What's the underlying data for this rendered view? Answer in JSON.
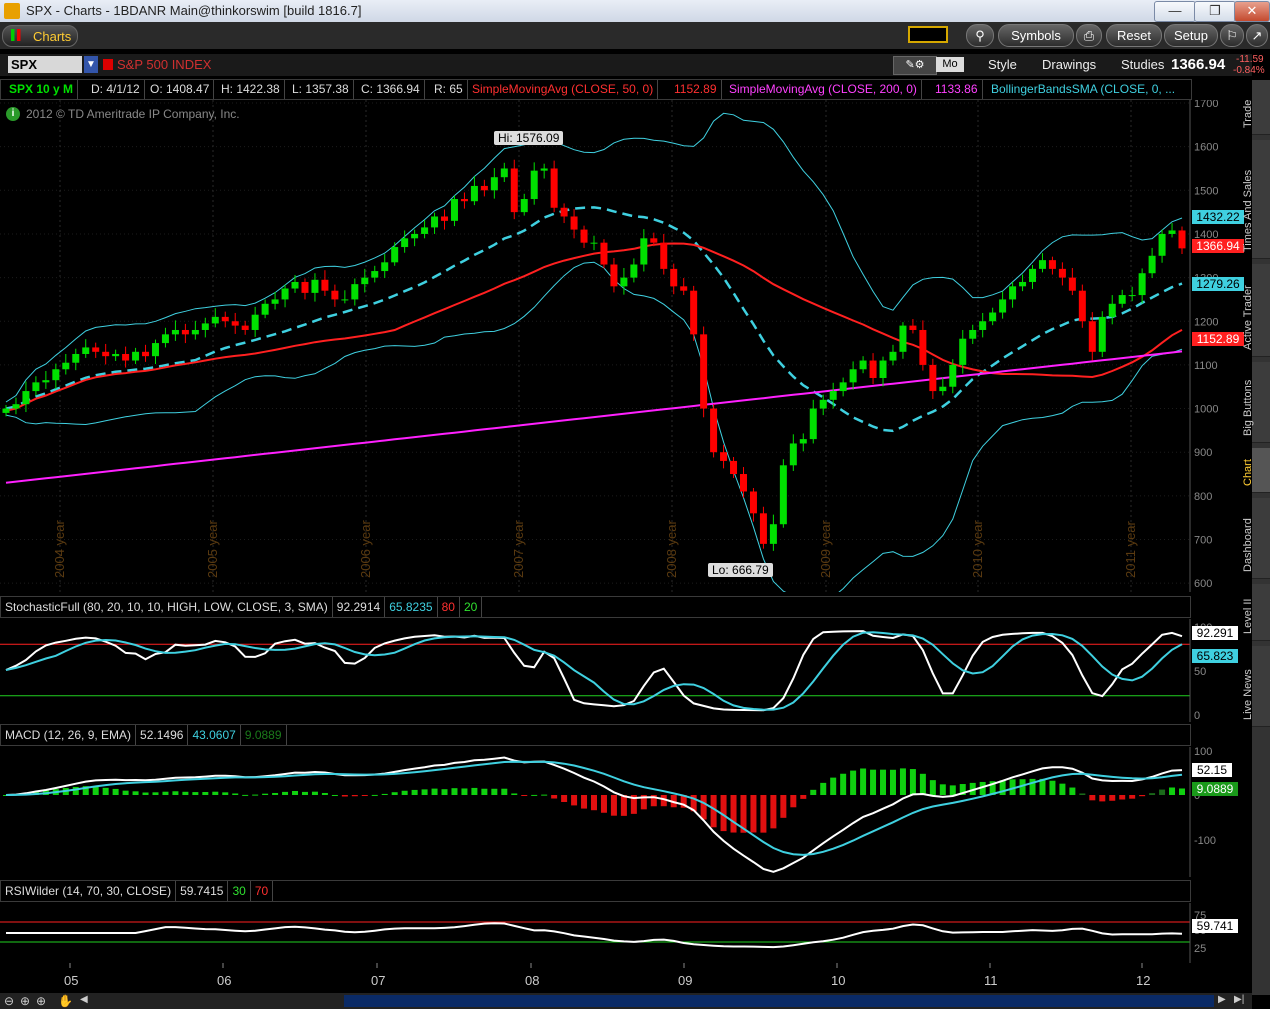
{
  "window": {
    "title": "SPX - Charts - 1BDANR Main@thinkorswim [build 1816.7]"
  },
  "toolbar": {
    "charts_label": "Charts",
    "symbols_label": "Symbols",
    "reset_label": "Reset",
    "setup_label": "Setup"
  },
  "symbolbar": {
    "symbol": "SPX",
    "description": "S&P 500 INDEX",
    "mo_label": "Mo",
    "style_label": "Style",
    "drawings_label": "Drawings",
    "studies_label": "Studies",
    "last_price": "1366.94",
    "change": "-11.59",
    "change_pct": "-0.84%"
  },
  "legend": {
    "title": "SPX 10 y M",
    "date": "D: 4/1/12",
    "open": "O: 1408.47",
    "high": "H: 1422.38",
    "low": "L: 1357.38",
    "close": "C: 1366.94",
    "range": "R: 65",
    "sma50": "SimpleMovingAvg (CLOSE, 50, 0)",
    "sma50_val": "1152.89",
    "sma200": "SimpleMovingAvg (CLOSE, 200, 0)",
    "sma200_val": "1133.86",
    "bb": "BollingerBandsSMA (CLOSE, 0, ..."
  },
  "copyright": "2012 © TD Ameritrade IP Company, Inc.",
  "price_panel": {
    "hi_label": "Hi: 1576.09",
    "lo_label": "Lo: 666.79",
    "axis_ticks": [
      "1700",
      "1600",
      "1500",
      "1400",
      "1300",
      "1200",
      "1100",
      "1000",
      "900",
      "800",
      "700",
      "600"
    ],
    "year_labels": [
      "2004 year",
      "2005 year",
      "2006 year",
      "2007 year",
      "2008 year",
      "2009 year",
      "2010 year",
      "2011 year"
    ],
    "price_tags": {
      "bb_upper": "1432.22",
      "close": "1366.94",
      "bb_mid": "1279.26",
      "sma": "1152.89"
    },
    "colors": {
      "up": "#00e000",
      "down": "#ff0000",
      "bb": "#3fd0e0",
      "sma50": "#ff2020",
      "sma200": "#ff20ff"
    }
  },
  "stoch_panel": {
    "title": "StochasticFull (80, 20, 10, 10, HIGH, LOW, CLOSE, 3, SMA)",
    "v1": "92.2914",
    "v2": "65.8235",
    "v3": "80",
    "v4": "20",
    "tag1": "92.291",
    "tag2": "65.823",
    "ticks": [
      "100",
      "50",
      "0"
    ]
  },
  "macd_panel": {
    "title": "MACD (12, 26, 9, EMA)",
    "v1": "52.1496",
    "v2": "43.0607",
    "v3": "9.0889",
    "tag1": "52.15",
    "tag2": "9.0889",
    "ticks": [
      "100",
      "0",
      "-100"
    ]
  },
  "rsi_panel": {
    "title": "RSIWilder (14, 70, 30, CLOSE)",
    "v1": "59.7415",
    "v2": "30",
    "v3": "70",
    "tag1": "59.741",
    "ticks": [
      "75",
      "50",
      "25"
    ]
  },
  "x_axis": [
    "05",
    "06",
    "07",
    "08",
    "09",
    "10",
    "11",
    "12"
  ],
  "side_tabs": [
    "Trade",
    "Times And Sales",
    "Active Trader",
    "Big Buttons",
    "Chart",
    "Dashboard",
    "Level II",
    "Live News"
  ]
}
